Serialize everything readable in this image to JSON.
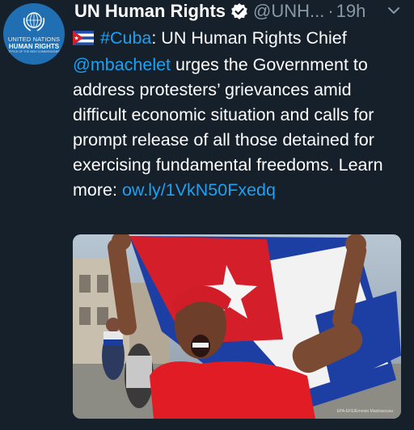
{
  "account": {
    "avatar_line1": "UNITED NATIONS",
    "avatar_line2": "HUMAN RIGHTS",
    "avatar_line3": "OFFICE OF THE HIGH COMMISSIONER",
    "display_name": "UN Human Rights",
    "handle": "@UNH...",
    "separator": "·",
    "time": "19h"
  },
  "tweet": {
    "hashtag": "#Cuba",
    "text1": ": UN Human Rights Chief",
    "mention": "@mbachelet",
    "text2": " urges the Government to address protesters’ grievances amid difficult economic situation and calls for prompt release of all those detained for exercising fundamental freedoms. Learn more: ",
    "link": "ow.ly/1VkN50Fxedq"
  },
  "photo": {
    "credit": "EPA-EFE/Ernesto Mastrascusa"
  },
  "colors": {
    "background": "#15202b",
    "accent": "#1da1f2",
    "muted": "#8899a6"
  },
  "icons": [
    "un-emblem-icon",
    "verified-badge-icon",
    "chevron-down-icon",
    "cuba-flag-icon"
  ]
}
